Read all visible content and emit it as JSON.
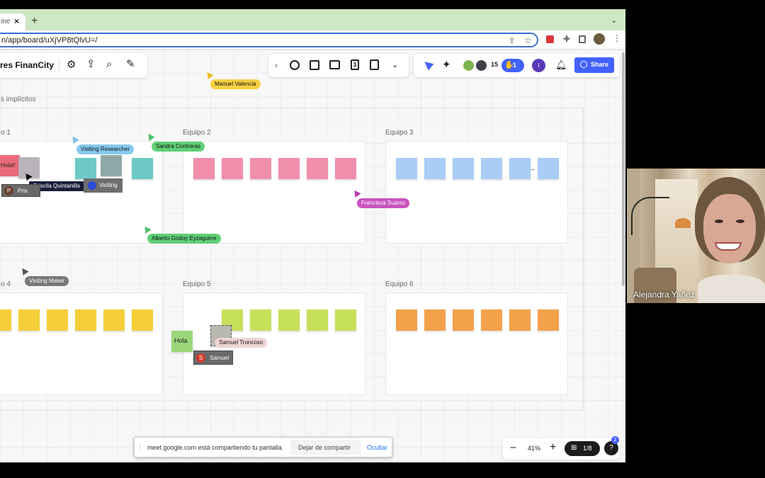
{
  "browser": {
    "tab_title": "ine",
    "tab_close": "×",
    "new_tab": "+",
    "tab_menu": "⌄",
    "url": "n/app/board/uXjVP8tQlvU=/"
  },
  "board": {
    "name": "res FinanCity",
    "section_label": "s implícitos",
    "share_label": "Share",
    "avatar_count": "15",
    "hand_count": "1",
    "timer_label": "3",
    "user_initial": "I",
    "colors": {
      "accent": "#4262ff",
      "pink": "#ef8fac",
      "teal": "#6ec9c4",
      "blue": "#a9cdf6",
      "yellow": "#f5cf3a",
      "lime": "#c7e05a",
      "orange": "#f3a14b"
    }
  },
  "teams": [
    {
      "name": "o 1"
    },
    {
      "name": "Equipo 2"
    },
    {
      "name": "Equipo 3"
    },
    {
      "name": "o 4"
    },
    {
      "name": "Equipo 5"
    },
    {
      "name": "Equipo 6"
    }
  ],
  "cursors": {
    "manuel": "Manuel Valencia",
    "visiting_researcher": "Visiting Researcher",
    "sandra": "Sandra Contreras",
    "priscila": "Priscila Quintanilla",
    "visiting": "Visiting",
    "francisca": "Francisca Suarez",
    "alberto": "Alberto Godoy Eyzaguirre",
    "visiting_maker": "Visiting Maker",
    "samuel_troncoso": "Samuel Troncoso",
    "samuel": "Samuel",
    "samuel_initial": "S",
    "pris": "Pris",
    "pris_initial": "P"
  },
  "notes": {
    "hola_big": "Hola!!",
    "hola": "Hola"
  },
  "zoom": {
    "minus": "−",
    "level": "41%",
    "plus": "+",
    "pages": "1/8",
    "help_badge": "2"
  },
  "screen_share": {
    "message": "meet.google.com está compartiendo tu pantalla.",
    "stop": "Dejar de compartir",
    "hide": "Ocultar"
  },
  "video": {
    "participant": "Alejandra Yañez"
  }
}
